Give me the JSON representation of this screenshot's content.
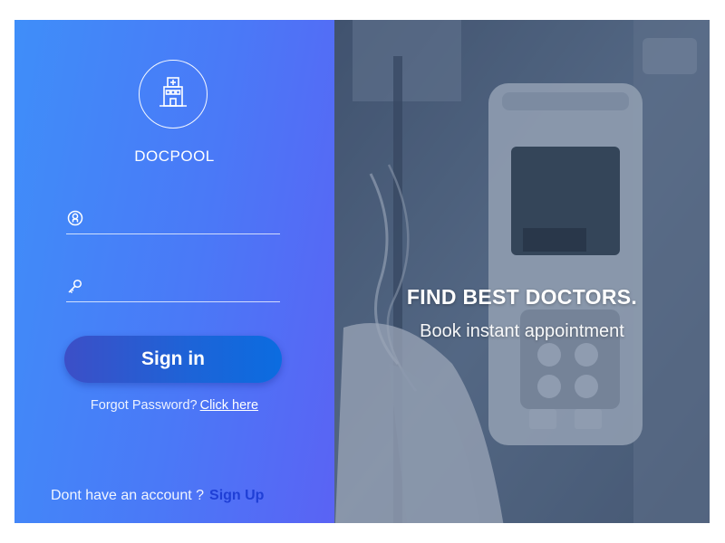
{
  "brand": {
    "name": "DOCPOOL",
    "logo_icon": "hospital-icon"
  },
  "login": {
    "username_icon": "user-icon",
    "username_value": "",
    "username_placeholder": "",
    "password_icon": "key-icon",
    "password_value": "",
    "password_placeholder": "",
    "signin_label": "Sign in",
    "forgot_text": "Forgot Password?",
    "forgot_link": "Click here",
    "signup_text": "Dont have an account ?",
    "signup_link": "Sign Up"
  },
  "hero": {
    "title": "FIND BEST DOCTORS.",
    "subtitle": "Book instant appointment"
  },
  "colors": {
    "gradient_start": "#3f8ef9",
    "gradient_end": "#5a63f4",
    "button": "#1c64d8",
    "signup_link": "#1f3fd6",
    "photo_tint": "#5c6f88"
  }
}
